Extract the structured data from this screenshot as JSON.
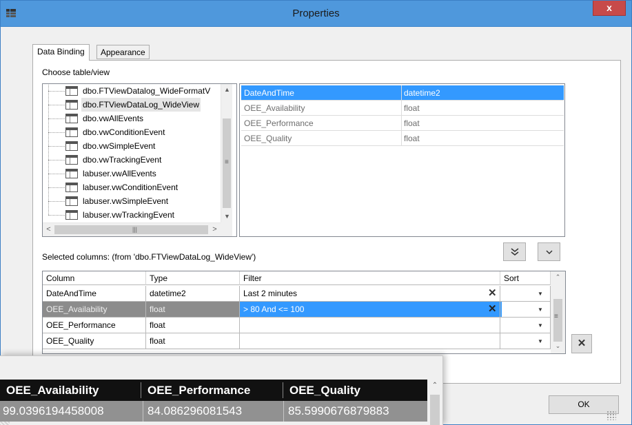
{
  "window": {
    "title": "Properties",
    "close_label": "x"
  },
  "tabs": [
    {
      "label": "Data Binding",
      "active": true
    },
    {
      "label": "Appearance",
      "active": false
    }
  ],
  "choose_label": "Choose table/view",
  "tree": {
    "items": [
      {
        "label": "dbo.FTViewDatalog_WideFormatV",
        "selected": false
      },
      {
        "label": "dbo.FTViewDataLog_WideView",
        "selected": true
      },
      {
        "label": "dbo.vwAllEvents",
        "selected": false
      },
      {
        "label": "dbo.vwConditionEvent",
        "selected": false
      },
      {
        "label": "dbo.vwSimpleEvent",
        "selected": false
      },
      {
        "label": "dbo.vwTrackingEvent",
        "selected": false
      },
      {
        "label": "labuser.vwAllEvents",
        "selected": false
      },
      {
        "label": "labuser.vwConditionEvent",
        "selected": false
      },
      {
        "label": "labuser.vwSimpleEvent",
        "selected": false
      },
      {
        "label": "labuser.vwTrackingEvent",
        "selected": false
      }
    ]
  },
  "columns_list": [
    {
      "name": "DateAndTime",
      "type": "datetime2",
      "selected": true
    },
    {
      "name": "OEE_Availability",
      "type": "float",
      "selected": false
    },
    {
      "name": "OEE_Performance",
      "type": "float",
      "selected": false
    },
    {
      "name": "OEE_Quality",
      "type": "float",
      "selected": false
    }
  ],
  "selected_label": "Selected columns: (from 'dbo.FTViewDataLog_WideView')",
  "grid": {
    "headers": [
      "Column",
      "Type",
      "Filter",
      "Sort"
    ],
    "rows": [
      {
        "column": "DateAndTime",
        "type": "datetime2",
        "filter": "Last 2 minutes",
        "sort": "",
        "selected": false
      },
      {
        "column": "OEE_Availability",
        "type": "float",
        "filter": "> 80 And <= 100",
        "sort": "",
        "selected": true
      },
      {
        "column": "OEE_Performance",
        "type": "float",
        "filter": "",
        "sort": "",
        "selected": false
      },
      {
        "column": "OEE_Quality",
        "type": "float",
        "filter": "",
        "sort": "",
        "selected": false
      }
    ]
  },
  "ok_label": "OK",
  "overlay": {
    "headers": [
      "OEE_Availability",
      "OEE_Performance",
      "OEE_Quality"
    ],
    "row": [
      "99.0396194458008",
      "84.086296081543",
      "85.5990676879883"
    ]
  },
  "icons": {
    "move_all_down": "double-chevron-down-icon",
    "move_down": "chevron-down-icon",
    "delete": "x-icon"
  },
  "colors": {
    "titlebar": "#4f98dc",
    "selection": "#3399ff",
    "close": "#c74a4a"
  }
}
